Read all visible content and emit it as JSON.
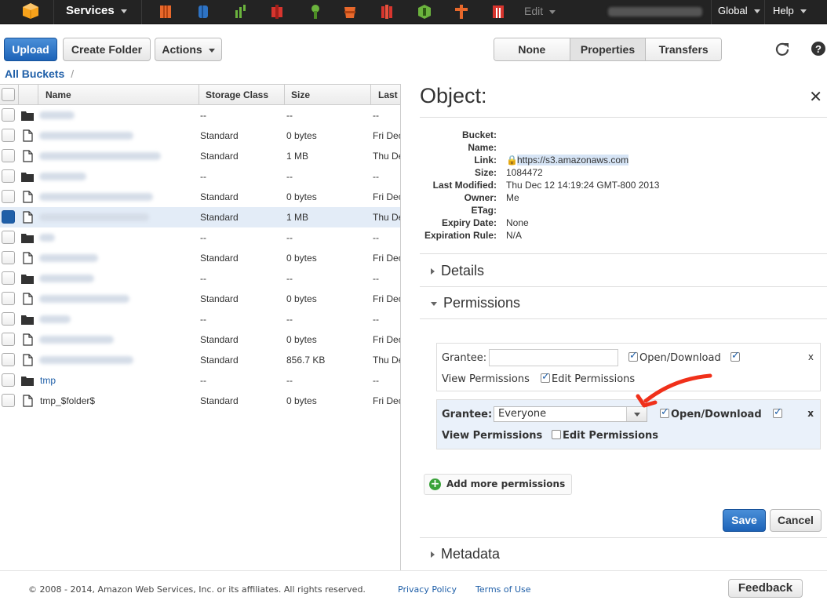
{
  "topnav": {
    "services_label": "Services",
    "edit_label": "Edit",
    "region_label": "Global",
    "help_label": "Help"
  },
  "toolbar": {
    "upload_label": "Upload",
    "create_folder_label": "Create Folder",
    "actions_label": "Actions",
    "view_tabs": [
      "None",
      "Properties",
      "Transfers"
    ],
    "active_tab": "Properties"
  },
  "breadcrumb": {
    "root": "All Buckets",
    "separator": "/"
  },
  "table": {
    "columns": [
      "Name",
      "Storage Class",
      "Size",
      "Last"
    ],
    "rows": [
      {
        "type": "folder",
        "name": "",
        "storage": "--",
        "size": "--",
        "last": "--",
        "selected": false
      },
      {
        "type": "file",
        "name": "",
        "storage": "Standard",
        "size": "0 bytes",
        "last": "Fri Dec",
        "selected": false
      },
      {
        "type": "file",
        "name": "",
        "storage": "Standard",
        "size": "1 MB",
        "last": "Thu Dec",
        "selected": false
      },
      {
        "type": "folder",
        "name": "",
        "storage": "--",
        "size": "--",
        "last": "--",
        "selected": false
      },
      {
        "type": "file",
        "name": "",
        "storage": "Standard",
        "size": "0 bytes",
        "last": "Fri Dec",
        "selected": false
      },
      {
        "type": "file",
        "name": "",
        "storage": "Standard",
        "size": "1 MB",
        "last": "Thu Dec",
        "selected": true
      },
      {
        "type": "folder",
        "name": "",
        "storage": "--",
        "size": "--",
        "last": "--",
        "selected": false
      },
      {
        "type": "file",
        "name": "",
        "storage": "Standard",
        "size": "0 bytes",
        "last": "Fri Dec",
        "selected": false
      },
      {
        "type": "folder",
        "name": "",
        "storage": "--",
        "size": "--",
        "last": "--",
        "selected": false
      },
      {
        "type": "file",
        "name": "",
        "storage": "Standard",
        "size": "0 bytes",
        "last": "Fri Dec",
        "selected": false
      },
      {
        "type": "folder",
        "name": "",
        "storage": "--",
        "size": "--",
        "last": "--",
        "selected": false
      },
      {
        "type": "file",
        "name": "",
        "storage": "Standard",
        "size": "0 bytes",
        "last": "Fri Dec",
        "selected": false
      },
      {
        "type": "file",
        "name": "",
        "storage": "Standard",
        "size": "856.7 KB",
        "last": "Thu Dec",
        "selected": false
      },
      {
        "type": "folder",
        "name": "tmp",
        "storage": "--",
        "size": "--",
        "last": "--",
        "selected": false
      },
      {
        "type": "file",
        "name": "tmp_$folder$",
        "storage": "Standard",
        "size": "0 bytes",
        "last": "Fri Dec",
        "selected": false
      }
    ]
  },
  "panel": {
    "title": "Object:",
    "properties": {
      "bucket_label": "Bucket:",
      "name_label": "Name:",
      "link_label": "Link:",
      "link_value": "https://s3.amazonaws.com",
      "size_label": "Size:",
      "size_value": "1084472",
      "modified_label": "Last Modified:",
      "modified_value": "Thu Dec 12 14:19:24 GMT-800 2013",
      "owner_label": "Owner:",
      "owner_value": "Me",
      "etag_label": "ETag:",
      "expiry_label": "Expiry Date:",
      "expiry_value": "None",
      "rule_label": "Expiration Rule:",
      "rule_value": "N/A"
    },
    "details_label": "Details",
    "permissions_label": "Permissions",
    "metadata_label": "Metadata",
    "grant1": {
      "grantee_label": "Grantee:",
      "grantee_value": "",
      "open_download": "Open/Download",
      "view_permissions": "View Permissions",
      "edit_permissions": "Edit Permissions",
      "close": "x"
    },
    "grant2": {
      "grantee_label": "Grantee:",
      "grantee_value": "Everyone",
      "open_download": "Open/Download",
      "view_permissions": "View Permissions",
      "edit_permissions": "Edit Permissions",
      "close": "x"
    },
    "add_permissions_label": "Add more permissions",
    "save_label": "Save",
    "cancel_label": "Cancel"
  },
  "footer": {
    "copyright": "© 2008 - 2014, Amazon Web Services, Inc. or its affiliates. All rights reserved.",
    "privacy": "Privacy Policy",
    "terms": "Terms of Use",
    "feedback": "Feedback"
  },
  "colors": {
    "accent": "#1f5fa8",
    "primary_button": "#2b74c8",
    "nav_bg": "#232323",
    "annotation_arrow": "#f0301a"
  }
}
